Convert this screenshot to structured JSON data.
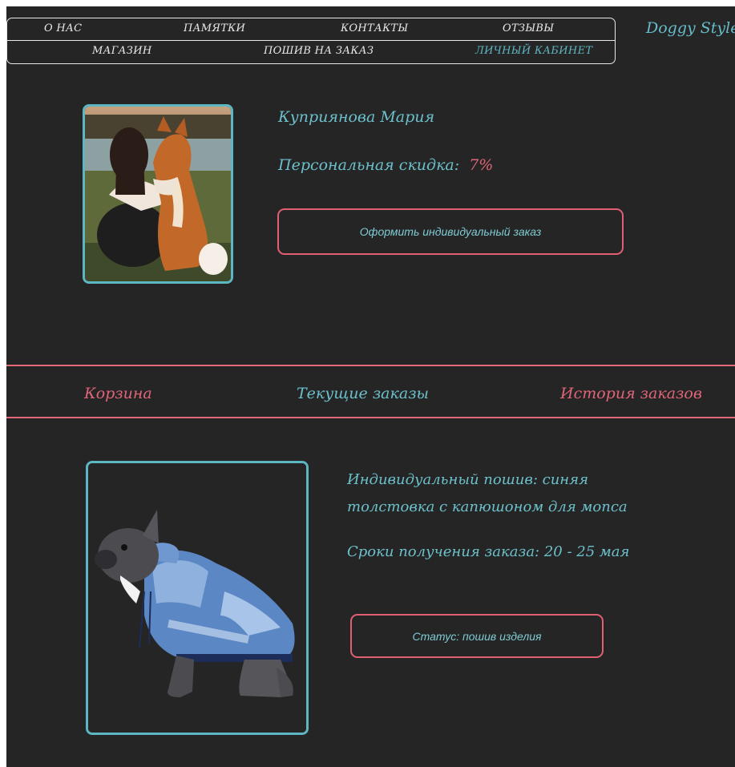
{
  "nav": {
    "items_row1": [
      "О НАС",
      "ПАМЯТКИ",
      "КОНТАКТЫ",
      "ОТЗЫВЫ"
    ],
    "items_row2": [
      "МАГАЗИН",
      "ПОШИВ НА ЗАКАЗ",
      "ЛИЧНЫЙ КАБИНЕТ"
    ],
    "brand": "Doggy Style"
  },
  "profile": {
    "name": "Куприянова Мария",
    "discount_label": "Персональная скидка:",
    "discount_value": "7%",
    "order_button": "Оформить индивидуальный заказ"
  },
  "tabs": [
    "Корзина",
    "Текущие заказы",
    "История заказов"
  ],
  "order": {
    "title_line1": "Индивидуальный пошив:  синяя",
    "title_line2": "толстовка с капюшоном для мопса",
    "dates": "Сроки получения заказа: 20 - 25 мая",
    "status_button": "Статус: пошив изделия"
  },
  "colors": {
    "accent_teal": "#5cb7c3",
    "accent_pink": "#e05f72",
    "background": "#252525"
  },
  "icons": [
    "profile-photo-woman-with-dog",
    "french-bulldog-in-hoodie-photo"
  ]
}
